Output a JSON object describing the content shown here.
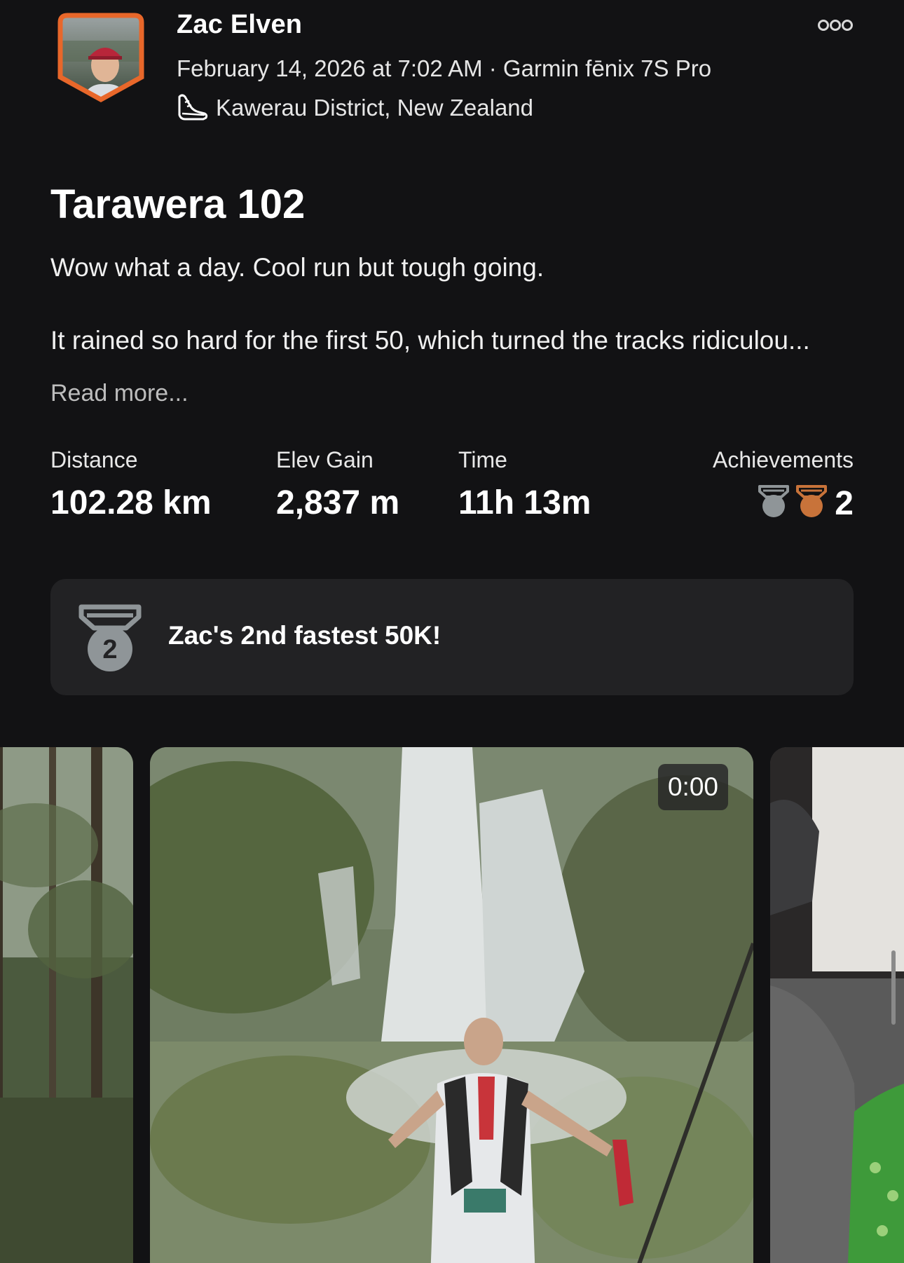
{
  "activity": {
    "athlete_name": "Zac Elven",
    "meta_line": "February 14, 2026 at 7:02 AM · Garmin fēnix 7S Pro",
    "location": "Kawerau District, New Zealand",
    "title": "Tarawera 102",
    "description_line1": "Wow what a day. Cool run but tough going.",
    "description_line2": "It rained so hard for the first 50, which turned the tracks ridiculou...",
    "read_more": "Read more..."
  },
  "stats": [
    {
      "label": "Distance",
      "value": "102.28 km"
    },
    {
      "label": "Elev Gain",
      "value": "2,837 m"
    },
    {
      "label": "Time",
      "value": "11h 13m"
    }
  ],
  "achievements": {
    "label": "Achievements",
    "count": "2"
  },
  "achievement_card": {
    "medal_number": "2",
    "text": "Zac's 2nd fastest 50K!"
  },
  "media": {
    "video_duration": "0:00"
  },
  "icons": {
    "more": "more-options-icon",
    "shoe": "shoe-icon",
    "silver_medal": "silver-medal-icon",
    "bronze_medal": "bronze-medal-icon",
    "pr_medal": "second-place-medal-icon"
  },
  "colors": {
    "background": "#121214",
    "card": "#222224",
    "avatar_border": "#e8672a",
    "bronze": "#c8733a",
    "silver": "#8f9598"
  }
}
